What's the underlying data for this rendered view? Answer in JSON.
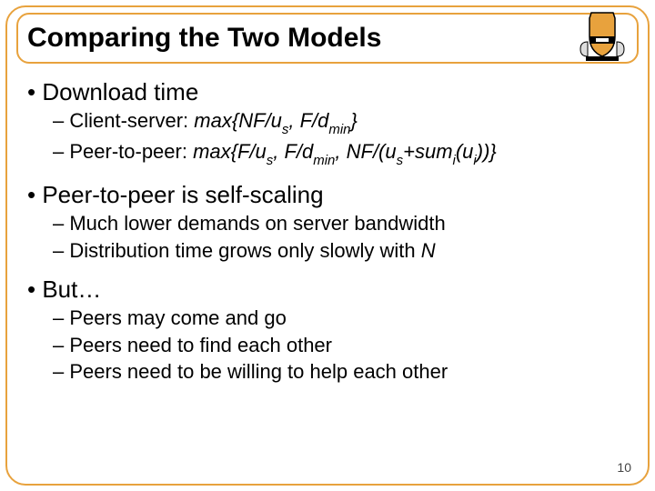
{
  "title": "Comparing the Two Models",
  "section1": {
    "heading": "• Download time",
    "item1_pre": "– Client-server: ",
    "item1_formula_a": "max{NF/u",
    "item1_sub_a": "s",
    "item1_formula_b": ", F/d",
    "item1_sub_b": "min",
    "item1_formula_c": "}",
    "item2_pre": "– Peer-to-peer: ",
    "item2_a": "max{F/u",
    "item2_sub_a": "s",
    "item2_b": ", F/d",
    "item2_sub_b": "min",
    "item2_c": ", NF/(u",
    "item2_sub_c": "s",
    "item2_d": "+sum",
    "item2_sub_d": "i",
    "item2_e": "(u",
    "item2_sub_e": "i",
    "item2_f": "))}"
  },
  "section2": {
    "heading": "• Peer-to-peer is self-scaling",
    "item1": "– Much lower demands on server bandwidth",
    "item2_pre": "– Distribution time grows only slowly with ",
    "item2_ital": "N"
  },
  "section3": {
    "heading": "• But…",
    "item1": "– Peers may come and go",
    "item2": "– Peers need to find each other",
    "item3": "– Peers need to be willing to help each other"
  },
  "slide_number": "10"
}
